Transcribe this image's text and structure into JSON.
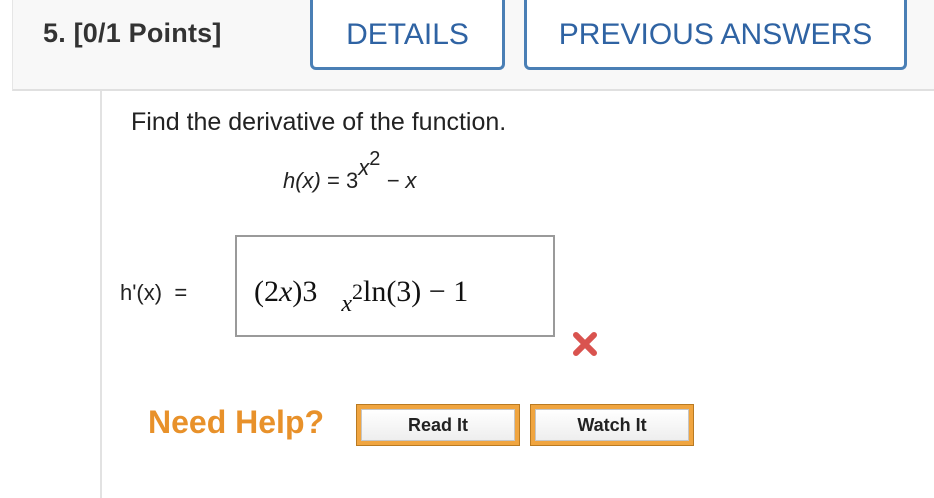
{
  "header": {
    "question_label": "5.  [0/1 Points]",
    "details_label": "DETAILS",
    "previous_answers_label": "PREVIOUS ANSWERS"
  },
  "question": {
    "prompt": "Find the derivative of the function.",
    "function_lhs": "h(x)",
    "equals": " = ",
    "function_base": "3",
    "function_exp_base": "x",
    "function_exp_power": "2",
    "function_rest": " − x"
  },
  "answer": {
    "label": "h'(x)  =",
    "part1": "(2",
    "part1_var": "x",
    "part2": ")3",
    "exp_var": "x",
    "exp_power": "2",
    "part3": "ln(3) − 1",
    "status": "incorrect",
    "status_color": "#d9534f"
  },
  "help": {
    "label": "Need Help?",
    "read_it_label": "Read It",
    "watch_it_label": "Watch It"
  }
}
